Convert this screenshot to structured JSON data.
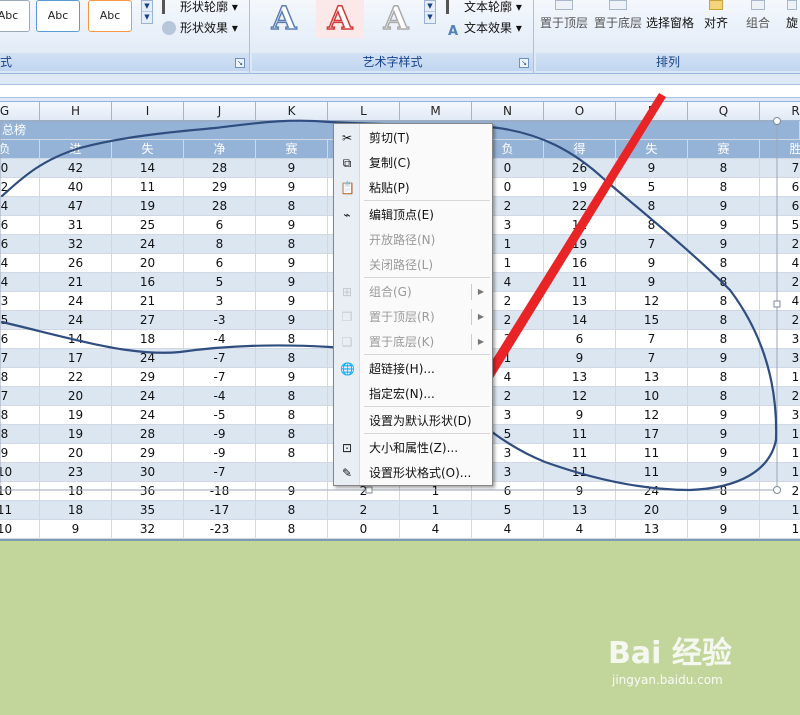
{
  "ribbon": {
    "shape_style_samples": [
      "Abc",
      "Abc",
      "Abc"
    ],
    "shape_outline_label": "形状轮廓",
    "shape_effect_label": "形状效果",
    "shape_group_tail": "式",
    "wordart_letters": [
      "A",
      "A",
      "A"
    ],
    "text_outline_label": "文本轮廓",
    "text_effect_label": "文本效果",
    "wordart_group_label": "艺术字样式",
    "bring_front_label": "置于顶层",
    "send_back_label": "置于底层",
    "selection_pane_label": "选择窗格",
    "align_label": "对齐",
    "group_label": "组合",
    "rotate_label": "旋",
    "arrange_group_label": "排列"
  },
  "columns": [
    "G",
    "H",
    "I",
    "J",
    "K",
    "L",
    "M",
    "N",
    "O",
    "P",
    "Q",
    "R"
  ],
  "sheet": {
    "title_row": "总榜",
    "header_row": [
      "负",
      "进",
      "失",
      "净",
      "赛",
      "",
      "",
      "负",
      "得",
      "失",
      "赛",
      "胜"
    ],
    "rows": [
      [
        "0",
        "42",
        "14",
        "28",
        "9",
        "",
        "",
        "0",
        "26",
        "9",
        "8",
        "7"
      ],
      [
        "2",
        "40",
        "11",
        "29",
        "9",
        "",
        "",
        "0",
        "19",
        "5",
        "8",
        "6"
      ],
      [
        "4",
        "47",
        "19",
        "28",
        "8",
        "",
        "",
        "2",
        "22",
        "8",
        "9",
        "6"
      ],
      [
        "6",
        "31",
        "25",
        "6",
        "9",
        "",
        "",
        "3",
        "11",
        "8",
        "9",
        "5"
      ],
      [
        "6",
        "32",
        "24",
        "8",
        "8",
        "",
        "",
        "1",
        "19",
        "7",
        "9",
        "2"
      ],
      [
        "4",
        "26",
        "20",
        "6",
        "9",
        "",
        "",
        "1",
        "16",
        "9",
        "8",
        "4"
      ],
      [
        "4",
        "21",
        "16",
        "5",
        "9",
        "",
        "",
        "4",
        "11",
        "9",
        "8",
        "2"
      ],
      [
        "3",
        "24",
        "21",
        "3",
        "9",
        "",
        "",
        "2",
        "13",
        "12",
        "8",
        "4"
      ],
      [
        "5",
        "24",
        "27",
        "-3",
        "9",
        "",
        "",
        "2",
        "14",
        "15",
        "8",
        "2"
      ],
      [
        "6",
        "14",
        "18",
        "-4",
        "8",
        "",
        "",
        "3",
        "6",
        "7",
        "8",
        "3"
      ],
      [
        "7",
        "17",
        "24",
        "-7",
        "8",
        "",
        "",
        "1",
        "9",
        "7",
        "9",
        "3"
      ],
      [
        "8",
        "22",
        "29",
        "-7",
        "9",
        "",
        "",
        "4",
        "13",
        "13",
        "8",
        "1"
      ],
      [
        "7",
        "20",
        "24",
        "-4",
        "8",
        "",
        "",
        "2",
        "12",
        "10",
        "8",
        "2"
      ],
      [
        "8",
        "19",
        "24",
        "-5",
        "8",
        "",
        "",
        "3",
        "9",
        "12",
        "9",
        "3"
      ],
      [
        "8",
        "19",
        "28",
        "-9",
        "8",
        "",
        "",
        "5",
        "11",
        "17",
        "9",
        "1"
      ],
      [
        "9",
        "20",
        "29",
        "-9",
        "8",
        "",
        "",
        "3",
        "11",
        "11",
        "9",
        "1"
      ],
      [
        "10",
        "23",
        "30",
        "-7",
        "",
        "",
        "",
        "3",
        "11",
        "11",
        "9",
        "1"
      ],
      [
        "10",
        "18",
        "36",
        "-18",
        "9",
        "2",
        "1",
        "6",
        "9",
        "24",
        "8",
        "2"
      ],
      [
        "11",
        "18",
        "35",
        "-17",
        "8",
        "2",
        "1",
        "5",
        "13",
        "20",
        "9",
        "1"
      ],
      [
        "10",
        "9",
        "32",
        "-23",
        "8",
        "0",
        "4",
        "4",
        "4",
        "13",
        "9",
        "1"
      ]
    ]
  },
  "context_menu": {
    "items": [
      {
        "label": "剪切(T)",
        "icon": "scissors-icon",
        "glyph": "✂",
        "disabled": false,
        "submenu": false
      },
      {
        "label": "复制(C)",
        "icon": "copy-icon",
        "glyph": "⧉",
        "disabled": false,
        "submenu": false
      },
      {
        "label": "粘贴(P)",
        "icon": "paste-icon",
        "glyph": "📋",
        "disabled": false,
        "submenu": false
      },
      {
        "label": "编辑顶点(E)",
        "icon": "edit-points-icon",
        "glyph": "⌁",
        "disabled": false,
        "submenu": false
      },
      {
        "label": "开放路径(N)",
        "icon": "",
        "glyph": "",
        "disabled": true,
        "submenu": false
      },
      {
        "label": "关闭路径(L)",
        "icon": "",
        "glyph": "",
        "disabled": true,
        "submenu": false
      },
      {
        "label": "组合(G)",
        "icon": "group-icon",
        "glyph": "⊞",
        "disabled": true,
        "submenu": true
      },
      {
        "label": "置于顶层(R)",
        "icon": "bring-front-icon",
        "glyph": "❐",
        "disabled": true,
        "submenu": true
      },
      {
        "label": "置于底层(K)",
        "icon": "send-back-icon",
        "glyph": "❏",
        "disabled": true,
        "submenu": true
      },
      {
        "label": "超链接(H)...",
        "icon": "hyperlink-icon",
        "glyph": "🌐",
        "disabled": false,
        "submenu": false
      },
      {
        "label": "指定宏(N)...",
        "icon": "",
        "glyph": "",
        "disabled": false,
        "submenu": false
      },
      {
        "label": "设置为默认形状(D)",
        "icon": "",
        "glyph": "",
        "disabled": false,
        "submenu": false
      },
      {
        "label": "大小和属性(Z)...",
        "icon": "size-properties-icon",
        "glyph": "⊡",
        "disabled": false,
        "submenu": false
      },
      {
        "label": "设置形状格式(O)...",
        "icon": "format-shape-icon",
        "glyph": "✎",
        "disabled": false,
        "submenu": false
      }
    ]
  },
  "colors": {
    "header_blue": "#95b3d7",
    "alt_row": "#dce6f1",
    "freeform_line": "#2f4d7e",
    "arrow_red": "#e8141b",
    "background_green": "#c2d69b"
  },
  "watermark": {
    "logo": "Bai 经验",
    "url": "jingyan.baidu.com"
  }
}
